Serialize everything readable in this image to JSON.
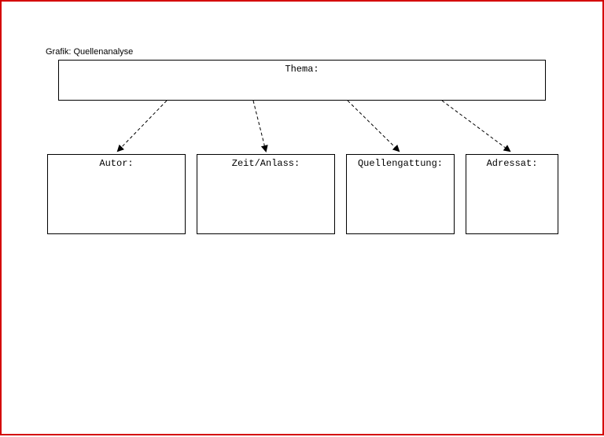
{
  "title": "Grafik: Quellenanalyse",
  "boxes": {
    "thema": "Thema:",
    "autor": "Autor:",
    "zeit": "Zeit/Anlass:",
    "quellen": "Quellengattung:",
    "adressat": "Adressat:"
  }
}
